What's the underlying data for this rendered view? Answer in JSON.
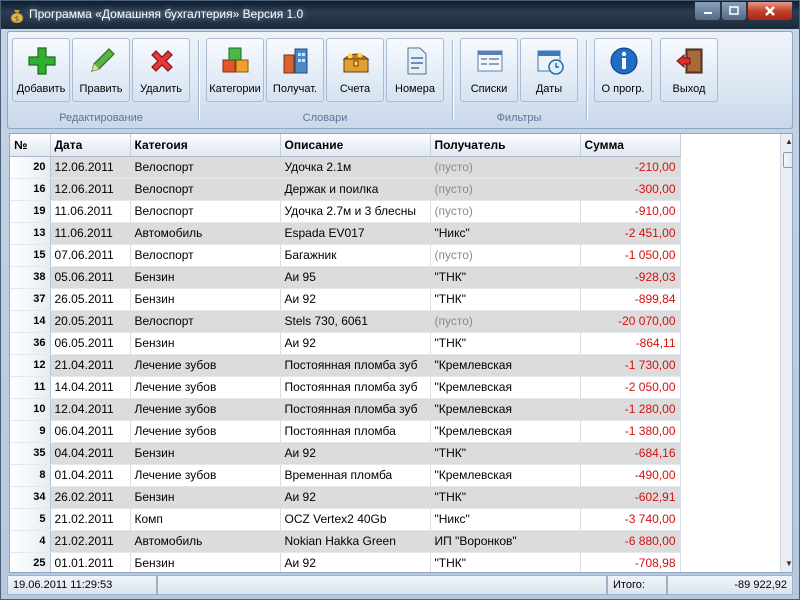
{
  "window": {
    "title": "Программа «Домашняя бухгалтерия» Версия 1.0",
    "controls": {
      "minimize": "—",
      "maximize": "□",
      "close": "✕"
    }
  },
  "toolbar": {
    "groups": [
      {
        "label": "Редактирование",
        "buttons": [
          {
            "label": "Добавить",
            "icon": "plus-icon",
            "color": "#2a9d2a"
          },
          {
            "label": "Править",
            "icon": "pencil-icon",
            "color": "#3b8d2a"
          },
          {
            "label": "Удалить",
            "icon": "red-x-icon",
            "color": "#cc2222"
          }
        ]
      },
      {
        "label": "Словари",
        "buttons": [
          {
            "label": "Категории",
            "icon": "cubes-icon",
            "color": "#e0762a"
          },
          {
            "label": "Получат.",
            "icon": "building-icon",
            "color": "#c85a28"
          },
          {
            "label": "Счета",
            "icon": "treasure-chest-icon",
            "color": "#d6a21e"
          },
          {
            "label": "Номера",
            "icon": "document-icon",
            "color": "#6a8fbf"
          }
        ]
      },
      {
        "label": "Фильтры",
        "buttons": [
          {
            "label": "Списки",
            "icon": "list-window-icon",
            "color": "#5b7fb0"
          },
          {
            "label": "Даты",
            "icon": "calendar-clock-icon",
            "color": "#3d7ab8"
          }
        ]
      },
      {
        "label": "",
        "buttons": [
          {
            "label": "О прогр.",
            "icon": "info-icon",
            "color": "#1f6dc4"
          },
          {
            "label": "Выход",
            "icon": "exit-door-icon",
            "color": "#b23030"
          }
        ]
      }
    ]
  },
  "grid": {
    "columns": [
      "№",
      "Дата",
      "Категоия",
      "Описание",
      "Получатель",
      "Сумма"
    ],
    "rows": [
      {
        "num": "20",
        "date": "12.06.2011",
        "category": "Велоспорт",
        "description": "Удочка 2.1м",
        "payee": "(пусто)",
        "sum": "-210,00"
      },
      {
        "num": "16",
        "date": "12.06.2011",
        "category": "Велоспорт",
        "description": "Держак и поилка",
        "payee": "(пусто)",
        "sum": "-300,00"
      },
      {
        "num": "19",
        "date": "11.06.2011",
        "category": "Велоспорт",
        "description": "Удочка 2.7м и 3 блесны",
        "payee": "(пусто)",
        "sum": "-910,00"
      },
      {
        "num": "13",
        "date": "11.06.2011",
        "category": "Автомобиль",
        "description": "Espada EV017",
        "payee": "\"Никс\"",
        "sum": "-2 451,00"
      },
      {
        "num": "15",
        "date": "07.06.2011",
        "category": "Велоспорт",
        "description": "Багажник",
        "payee": "(пусто)",
        "sum": "-1 050,00"
      },
      {
        "num": "38",
        "date": "05.06.2011",
        "category": "Бензин",
        "description": "Аи 95",
        "payee": "\"ТНК\"",
        "sum": "-928,03"
      },
      {
        "num": "37",
        "date": "26.05.2011",
        "category": "Бензин",
        "description": "Аи 92",
        "payee": "\"ТНК\"",
        "sum": "-899,84"
      },
      {
        "num": "14",
        "date": "20.05.2011",
        "category": "Велоспорт",
        "description": "Stels 730, 6061",
        "payee": "(пусто)",
        "sum": "-20 070,00"
      },
      {
        "num": "36",
        "date": "06.05.2011",
        "category": "Бензин",
        "description": "Аи 92",
        "payee": "\"ТНК\"",
        "sum": "-864,11"
      },
      {
        "num": "12",
        "date": "21.04.2011",
        "category": "Лечение зубов",
        "description": "Постоянная пломба зуб",
        "payee": "\"Кремлевская",
        "sum": "-1 730,00"
      },
      {
        "num": "11",
        "date": "14.04.2011",
        "category": "Лечение зубов",
        "description": "Постоянная пломба зуб",
        "payee": "\"Кремлевская",
        "sum": "-2 050,00"
      },
      {
        "num": "10",
        "date": "12.04.2011",
        "category": "Лечение зубов",
        "description": "Постоянная пломба зуб",
        "payee": "\"Кремлевская",
        "sum": "-1 280,00"
      },
      {
        "num": "9",
        "date": "06.04.2011",
        "category": "Лечение зубов",
        "description": "Постоянная пломба",
        "payee": "\"Кремлевская",
        "sum": "-1 380,00"
      },
      {
        "num": "35",
        "date": "04.04.2011",
        "category": "Бензин",
        "description": "Аи 92",
        "payee": "\"ТНК\"",
        "sum": "-684,16"
      },
      {
        "num": "8",
        "date": "01.04.2011",
        "category": "Лечение зубов",
        "description": "Временная пломба",
        "payee": "\"Кремлевская",
        "sum": "-490,00"
      },
      {
        "num": "34",
        "date": "26.02.2011",
        "category": "Бензин",
        "description": "Аи 92",
        "payee": "\"ТНК\"",
        "sum": "-602,91"
      },
      {
        "num": "5",
        "date": "21.02.2011",
        "category": "Комп",
        "description": "OCZ Vertex2 40Gb",
        "payee": "\"Никс\"",
        "sum": "-3 740,00"
      },
      {
        "num": "4",
        "date": "21.02.2011",
        "category": "Автомобиль",
        "description": "Nokian Hakka Green",
        "payee": "ИП \"Воронков\"",
        "sum": "-6 880,00"
      },
      {
        "num": "25",
        "date": "01.01.2011",
        "category": "Бензин",
        "description": "Аи 92",
        "payee": "\"ТНК\"",
        "sum": "-708,98"
      }
    ]
  },
  "status": {
    "datetime": "19.06.2011 11:29:53",
    "total_label": "Итого:",
    "total_value": "-89 922,92"
  },
  "colors": {
    "negative_sum": "#d41010",
    "empty_payee": "#8a8a8a",
    "alt_row": "#dcdcdc"
  }
}
